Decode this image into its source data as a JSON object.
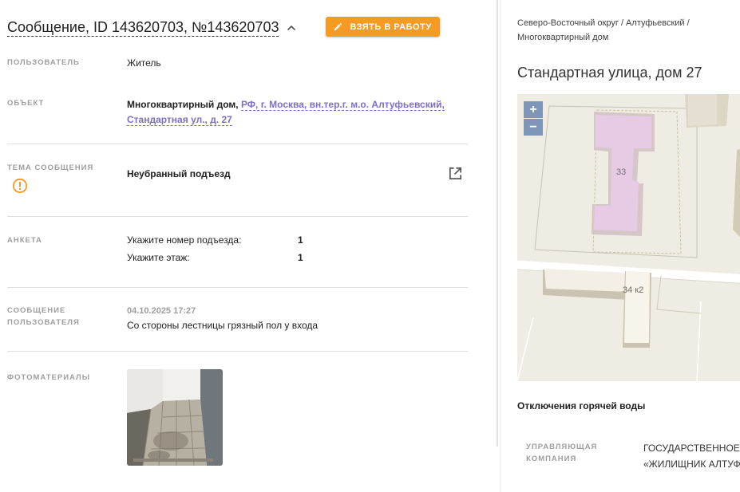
{
  "header": {
    "title": "Сообщение, ID 143620703, №143620703",
    "take_button": "ВЗЯТЬ В РАБОТУ"
  },
  "details": {
    "user_label": "ПОЛЬЗОВАТЕЛЬ",
    "user_value": "Житель",
    "object_label": "ОБЪЕКТ",
    "object_type": "Многоквартирный дом,",
    "object_address": "РФ, г. Москва, вн.тер.г. м.о. Алтуфьевский, Стандартная ул., д. 27",
    "topic_label": "ТЕМА СООБЩЕНИЯ",
    "topic_value": "Неубранный подъезд",
    "survey_label": "АНКЕТА",
    "survey": [
      {
        "question": "Укажите номер подъезда:",
        "answer": "1"
      },
      {
        "question": "Укажите этаж:",
        "answer": "1"
      }
    ],
    "message_label_1": "СООБЩЕНИЕ",
    "message_label_2": "ПОЛЬЗОВАТЕЛЯ",
    "message_date": "04.10.2025 17:27",
    "message_text": "Со стороны лестницы грязный пол у входа",
    "photos_label": "ФОТОМАТЕРИАЛЫ"
  },
  "right_panel": {
    "breadcrumb": "Северо-Восточный округ / Алтуфьевский / Многоквартирный дом",
    "address": "Стандартная улица, дом 27",
    "map": {
      "zoom_in": "+",
      "zoom_out": "−",
      "building_1": "33",
      "building_2": "34 к2"
    },
    "hot_water_title": "Отключения горячей воды",
    "uk_label": "УПРАВЛЯЮЩАЯ КОМПАНИЯ",
    "uk_value_1": "ГОСУДАРСТВЕННОЕ",
    "uk_value_2": "«ЖИЛИЩНИК АЛТУФ"
  },
  "colors": {
    "accent_orange": "#f59a23",
    "link_purple": "#7d6fc9",
    "warning_orange": "#f59a23",
    "map_zoom": "#7e97b8"
  }
}
